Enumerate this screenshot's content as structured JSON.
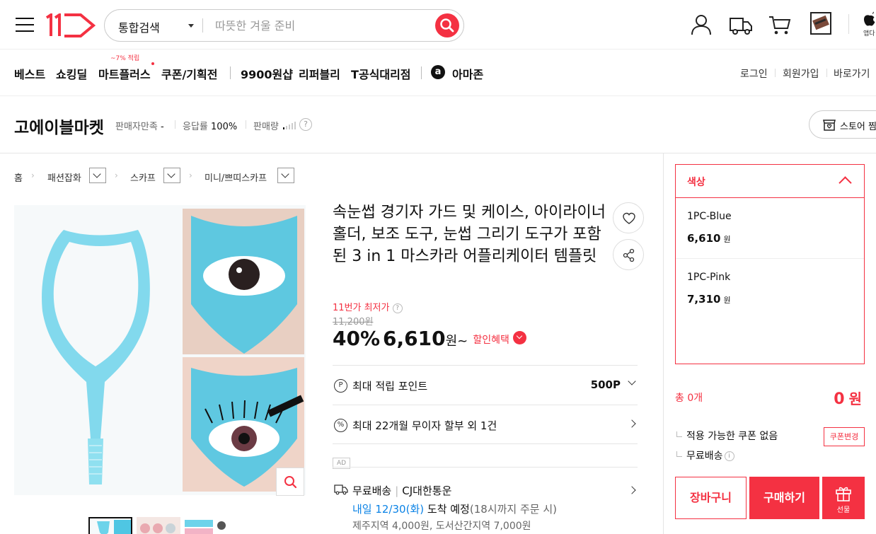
{
  "header": {
    "logo_icon": "11st-logo",
    "search_scope": "통합검색",
    "search_placeholder": "따뜻한 겨울 준비",
    "icons": [
      "user-icon",
      "truck-icon",
      "cart-icon",
      "recent-items-icon",
      "apple-icon"
    ],
    "app_label": "앱다"
  },
  "nav": {
    "items": [
      "베스트",
      "쇼킹딜",
      "마트플러스",
      "쿠폰/기획전",
      "9900원샵",
      "리퍼블리",
      "T공식대리점",
      "아마존"
    ],
    "badge": "~7% 적립",
    "amazon_glyph": "a",
    "right": [
      "로그인",
      "회원가입",
      "바로가기"
    ]
  },
  "seller": {
    "name": "고에이블마켓",
    "satisfaction_label": "판매자만족",
    "satisfaction_value": "-",
    "response_label": "응답률",
    "response_value": "100%",
    "sales_label": "판매량",
    "help": "?",
    "store_button": "스토어 찜"
  },
  "breadcrumb": [
    "홈",
    "패션잡화",
    "스카프",
    "미니/쁘띠스카프"
  ],
  "product": {
    "title": "속눈썹 경기자 가드 및 케이스, 아이라이너 홀더, 보조 도구, 눈썹 그리기 도구가 포함된 3 in 1 마스카라 어플리케이터 템플릿",
    "lowest_label": "11번가 최저가",
    "original_price": "11,200원",
    "discount": "40%",
    "price": "6,610",
    "won": "원~",
    "discount_benefit": "할인혜택",
    "points_label": "최대 적립 포인트",
    "points_value": "500P",
    "installment": "최대 22개월 무이자 할부 외 1건",
    "ad": "AD",
    "shipping": "무료배송",
    "carrier": "CJ대한통운",
    "delivery_date": "내일 12/30(화)",
    "delivery_text": "도착 예정",
    "delivery_note": "(18시까지 주문 시)",
    "extra_shipping": "제주지역 4,000원, 도서산간지역 7,000원"
  },
  "options": {
    "label": "색상",
    "items": [
      {
        "name": "1PC-Blue",
        "price": "6,610",
        "won": "원"
      },
      {
        "name": "1PC-Pink",
        "price": "7,310",
        "won": "원"
      }
    ]
  },
  "order": {
    "total_label": "총 0개",
    "total_value": "0",
    "total_won": "원",
    "coupon_text": "적용 가능한 쿠폰 없음",
    "coupon_button": "쿠폰변경",
    "free_shipping": "무료배송",
    "cart_button": "장바구니",
    "buy_button": "구매하기",
    "gift_button": "선물"
  },
  "colors": {
    "accent": "#f43142",
    "link": "#0b83e6"
  }
}
